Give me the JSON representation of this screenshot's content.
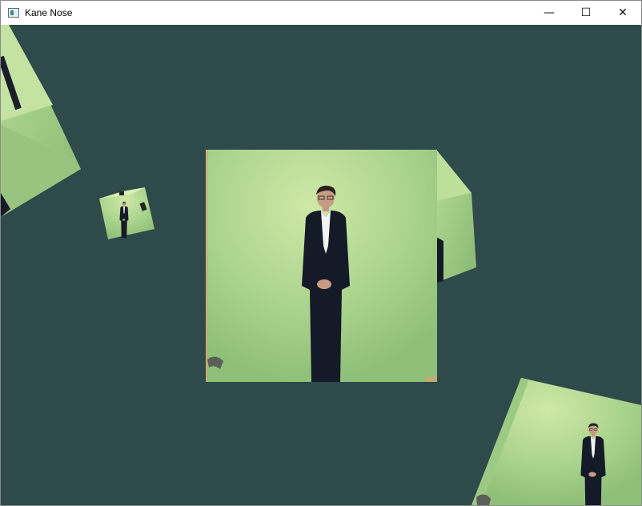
{
  "window": {
    "title": "Kane Nose",
    "controls": {
      "minimize": "—",
      "maximize": "☐",
      "close": "✕"
    }
  },
  "scene": {
    "background_color": "#2f4a4a",
    "texture_wall_color": "#bfe0a0"
  }
}
